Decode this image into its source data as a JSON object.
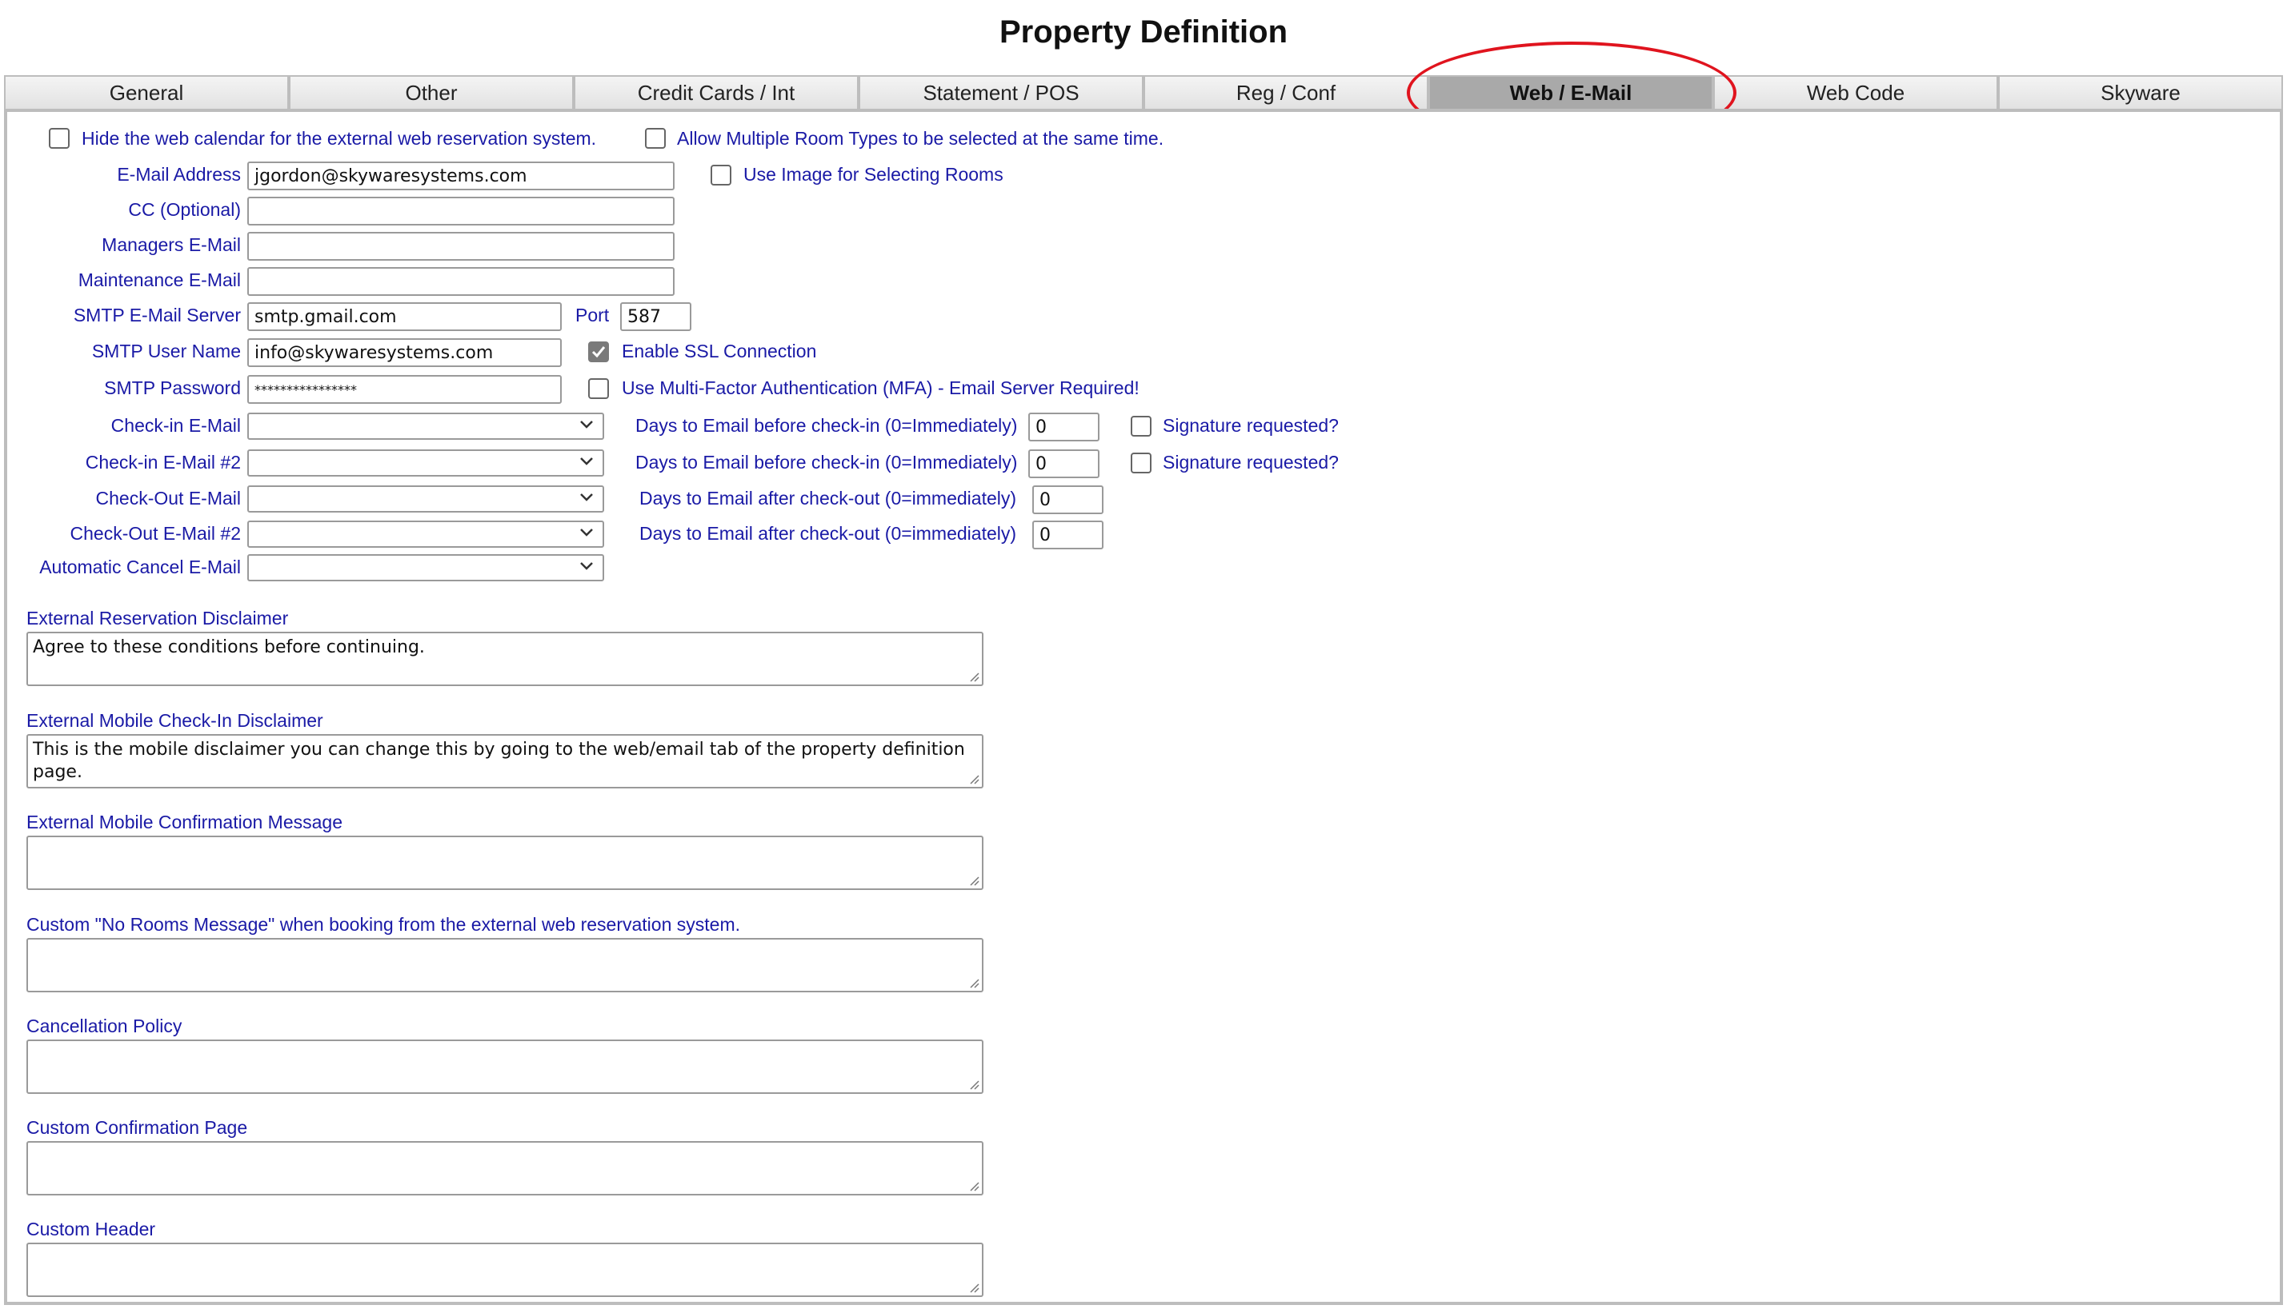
{
  "page": {
    "title": "Property Definition"
  },
  "tabs": [
    {
      "label": "General"
    },
    {
      "label": "Other"
    },
    {
      "label": "Credit Cards / Int"
    },
    {
      "label": "Statement / POS"
    },
    {
      "label": "Reg / Conf"
    },
    {
      "label": "Web / E-Mail",
      "active": true
    },
    {
      "label": "Web Code"
    },
    {
      "label": "Skyware"
    }
  ],
  "annotation": {
    "color": "#e0141e",
    "shape": "ellipse",
    "target": "Web / E-Mail"
  },
  "options": {
    "hide_web_calendar": {
      "label": "Hide the web calendar for the external web reservation system.",
      "checked": false
    },
    "allow_multiple_room_types": {
      "label": "Allow Multiple Room Types to be selected at the same time.",
      "checked": false
    },
    "use_image_rooms": {
      "label": "Use Image for Selecting Rooms",
      "checked": false
    },
    "enable_ssl": {
      "label": "Enable SSL Connection",
      "checked": true
    },
    "use_mfa": {
      "label": "Use Multi-Factor Authentication (MFA) - Email Server Required!",
      "checked": false
    }
  },
  "fields": {
    "email_address": {
      "label": "E-Mail Address",
      "value": "jgordon@skywaresystems.com"
    },
    "cc": {
      "label": "CC (Optional)",
      "value": ""
    },
    "managers_email": {
      "label": "Managers E-Mail",
      "value": ""
    },
    "maintenance_email": {
      "label": "Maintenance E-Mail",
      "value": ""
    },
    "smtp_server": {
      "label": "SMTP E-Mail Server",
      "value": "smtp.gmail.com"
    },
    "port": {
      "label": "Port",
      "value": "587"
    },
    "smtp_user": {
      "label": "SMTP User Name",
      "value": "info@skywaresystems.com"
    },
    "smtp_password": {
      "label": "SMTP Password",
      "value": "****************"
    }
  },
  "email_selects": [
    {
      "label": "Check-in E-Mail",
      "value": "",
      "days_label": "Days to Email before check-in (0=Immediately)",
      "days": "0",
      "signature_label": "Signature requested?",
      "signature": false
    },
    {
      "label": "Check-in E-Mail #2",
      "value": "",
      "days_label": "Days to Email before check-in (0=Immediately)",
      "days": "0",
      "signature_label": "Signature requested?",
      "signature": false
    },
    {
      "label": "Check-Out E-Mail",
      "value": "",
      "days_label": "Days to Email after check-out (0=immediately)",
      "days": "0"
    },
    {
      "label": "Check-Out E-Mail #2",
      "value": "",
      "days_label": "Days to Email after check-out (0=immediately)",
      "days": "0"
    },
    {
      "label": "Automatic Cancel E-Mail",
      "value": ""
    }
  ],
  "textareas": [
    {
      "label": "External Reservation Disclaimer",
      "value": "Agree to these conditions before continuing."
    },
    {
      "label": "External Mobile Check-In Disclaimer",
      "value": "This is the mobile disclaimer you can change this by going to the web/email tab of the property definition page."
    },
    {
      "label": "External Mobile Confirmation Message",
      "value": ""
    },
    {
      "label": "Custom \"No Rooms Message\" when booking from the external web reservation system.",
      "value": ""
    },
    {
      "label": "Cancellation Policy",
      "value": ""
    },
    {
      "label": "Custom Confirmation Page",
      "value": ""
    },
    {
      "label": "Custom Header",
      "value": ""
    }
  ],
  "colors": {
    "label_blue": "#1a1aa6",
    "active_tab": "#a9a9a9",
    "border": "#bdbdbd"
  }
}
